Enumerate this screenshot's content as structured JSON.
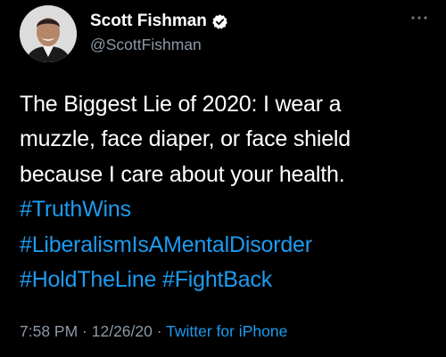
{
  "author": {
    "display_name": "Scott Fishman",
    "handle": "@ScottFishman",
    "verified_icon": "verified-badge-icon",
    "more_icon": "more-options-icon"
  },
  "tweet": {
    "text_line1": "The Biggest Lie of 2020: I wear a",
    "text_line2": "muzzle, face diaper, or face shield",
    "text_line3": "because I care about your health.",
    "hashtags": [
      "#TruthWins",
      "#LiberalismIsAMentalDisorder",
      "#HoldTheLine",
      "#FightBack"
    ]
  },
  "meta": {
    "time": "7:58 PM",
    "separator1": " · ",
    "date": "12/26/20",
    "separator2": " · ",
    "source": "Twitter for iPhone"
  },
  "colors": {
    "background": "#000000",
    "text": "#ffffff",
    "secondary": "#8b98a5",
    "link": "#1d9bf0"
  }
}
